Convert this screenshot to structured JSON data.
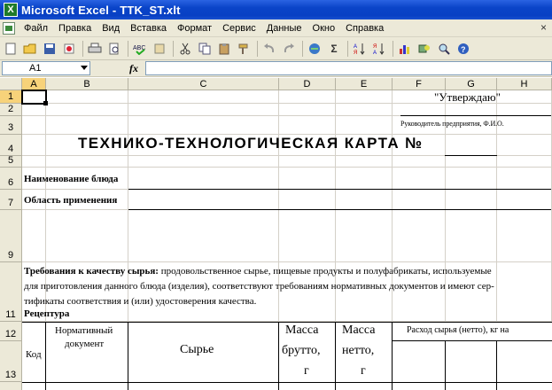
{
  "window": {
    "title": "Microsoft Excel - TTK_ST.xlt",
    "app_icon": "X"
  },
  "menu": {
    "items": [
      "Файл",
      "Правка",
      "Вид",
      "Вставка",
      "Формат",
      "Сервис",
      "Данные",
      "Окно",
      "Справка"
    ],
    "close": "×"
  },
  "toolbar": {
    "sum_label": "Σ"
  },
  "formula_bar": {
    "name_box": "A1",
    "fx": "fx",
    "value": ""
  },
  "grid": {
    "columns": [
      "A",
      "B",
      "C",
      "D",
      "E",
      "F",
      "G",
      "H"
    ],
    "rows": [
      "1",
      "2",
      "3",
      "4",
      "5",
      "6",
      "7",
      "9",
      "11",
      "12",
      "13"
    ],
    "selected_cell": "A1"
  },
  "sheet": {
    "approve": "\"Утверждаю\"",
    "head_signature": "Руководитель предприятия, Ф.И.О.",
    "main_title": "ТЕХНИКО-ТЕХНОЛОГИЧЕСКАЯ КАРТА №",
    "dish_name_label": "Наименование блюда",
    "scope_label": "Область применения",
    "quality_bold": "Требования к качеству сырья:",
    "quality_line1": " продовольственное сырье, пищевые продукты и полуфабрикаты, используемые",
    "quality_line2": "для приготовления данного блюда (изделия), соответствуют требованиям нормативных документов и имеют сер-",
    "quality_line3": "тификаты соответствия и (или) удостоверения качества.",
    "recipe_label": "Рецептура",
    "table": {
      "code": "Код",
      "norm_doc_1": "Нормативный",
      "norm_doc_2": "документ",
      "raw": "Сырье",
      "gross_1": "Масса",
      "gross_2": "брутто,",
      "gross_3": "г",
      "net_1": "Масса",
      "net_2": "нетто,",
      "net_3": "г",
      "consumption": "Расход сырья (нетто), кг на"
    }
  }
}
